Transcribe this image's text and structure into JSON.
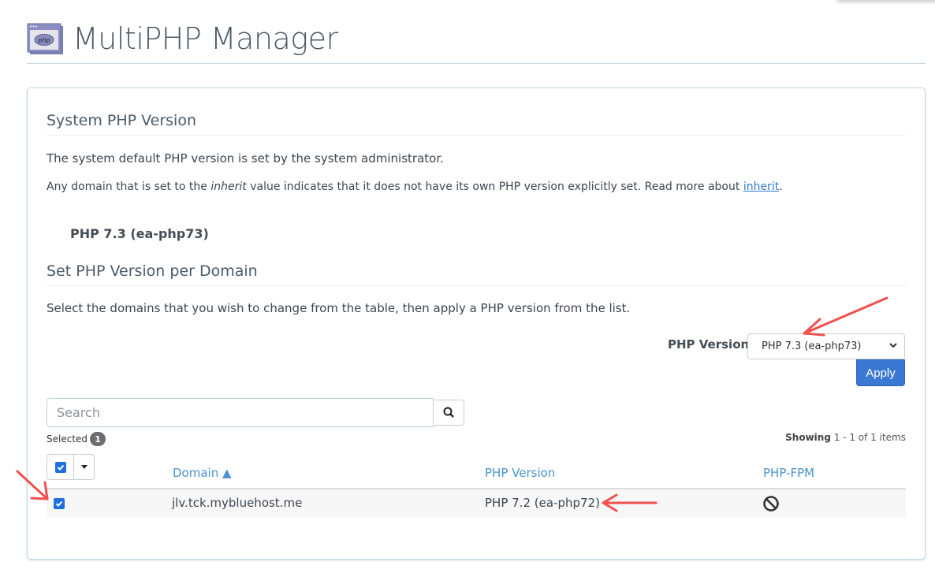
{
  "header": {
    "title": "MultiPHP Manager",
    "icon": "php-window-icon"
  },
  "system": {
    "title": "System PHP Version",
    "desc1": "The system default PHP version is set by the system administrator.",
    "desc2_pre": "Any domain that is set to the ",
    "desc2_em": "inherit",
    "desc2_mid": " value indicates that it does not have its own PHP version explicitly set. Read more about ",
    "desc2_link": "inherit",
    "desc2_post": ".",
    "current_version": "PHP 7.3 (ea-php73)"
  },
  "per_domain": {
    "title": "Set PHP Version per Domain",
    "desc": "Select the domains that you wish to change from the table, then apply a PHP version from the list.",
    "version_label": "PHP Version",
    "version_selected": "PHP 7.3 (ea-php73)",
    "apply_label": "Apply"
  },
  "search": {
    "placeholder": "Search",
    "value": ""
  },
  "selection": {
    "label": "Selected",
    "count": "1"
  },
  "pagination": {
    "showing_label": "Showing",
    "range": "1 - 1 of 1 items"
  },
  "table": {
    "columns": [
      {
        "label": "Domain ▲",
        "sorted": "ascending"
      },
      {
        "label": "PHP Version"
      },
      {
        "label": "PHP-FPM"
      }
    ],
    "rows": [
      {
        "checked": true,
        "domain": "jlv.tck.mybluehost.me",
        "php_version": "PHP 7.2 (ea-php72)",
        "php_fpm": "disabled-icon"
      }
    ]
  },
  "colors": {
    "accent": "#3a78d3",
    "link": "#2f7bd1",
    "column_header": "#4a93cf",
    "annotation_arrow": "#f0504f"
  }
}
